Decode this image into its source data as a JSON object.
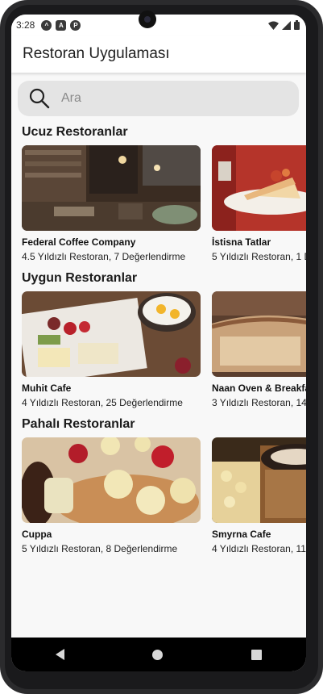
{
  "status": {
    "time": "3:28",
    "icons": [
      "assistant-icon",
      "a-icon",
      "p-icon"
    ]
  },
  "appbar": {
    "title": "Restoran Uygulaması"
  },
  "search": {
    "placeholder": "Ara"
  },
  "sections": [
    {
      "title": "Ucuz Restoranlar",
      "cards": [
        {
          "name": "Federal Coffee Company",
          "meta": "4.5 Yıldızlı Restoran, 7 Değerlendirme",
          "image": "cafe-interior"
        },
        {
          "name": "İstisna Tatlar",
          "meta": "5 Yıldızlı Restoran, 1 D",
          "image": "cake-slice"
        }
      ]
    },
    {
      "title": "Uygun Restoranlar",
      "cards": [
        {
          "name": "Muhit Cafe",
          "meta": "4 Yıldızlı Restoran, 25 Değerlendirme",
          "image": "breakfast-spread"
        },
        {
          "name": "Naan Oven & Breakfa",
          "meta": "3 Yıldızlı Restoran, 14",
          "image": "bread"
        }
      ]
    },
    {
      "title": "Pahalı Restoranlar",
      "cards": [
        {
          "name": "Cuppa",
          "meta": "5 Yıldızlı Restoran, 8 Değerlendirme",
          "image": "pancakes"
        },
        {
          "name": "Smyrna Cafe",
          "meta": "4 Yıldızlı Restoran, 11",
          "image": "coffee-dessert"
        }
      ]
    }
  ],
  "navbar": {
    "items": [
      "back-icon",
      "home-icon",
      "recents-icon"
    ]
  }
}
